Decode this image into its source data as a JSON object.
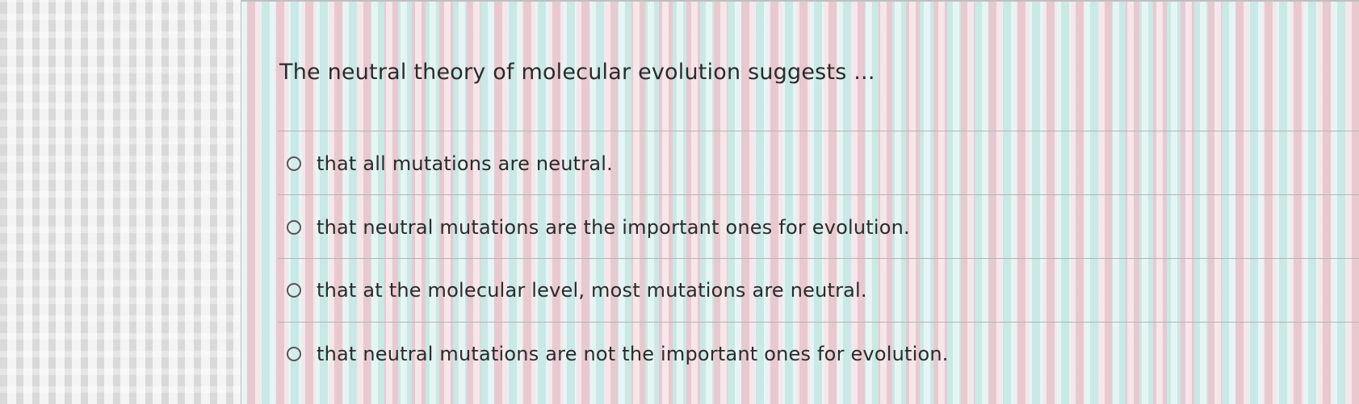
{
  "question": {
    "text": "The neutral theory of molecular evolution suggests ..."
  },
  "options": [
    {
      "label": "that all mutations are neutral.",
      "selected": false
    },
    {
      "label": "that neutral mutations are the important ones for evolution.",
      "selected": false
    },
    {
      "label": "that at the molecular level, most mutations are neutral.",
      "selected": false
    },
    {
      "label": "that neutral mutations are not the important ones for evolution.",
      "selected": false
    }
  ],
  "colors": {
    "text": "#2b2b2b",
    "divider": "#b5b5b5",
    "radio_border": "#555555"
  }
}
